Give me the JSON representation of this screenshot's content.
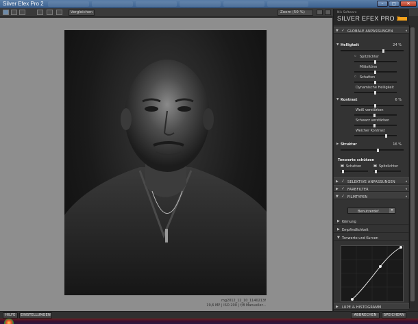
{
  "window": {
    "title": "Silver Efex Pro 2"
  },
  "toolbar": {
    "compare_label": "Vergleichen",
    "zoom_label": "Zoom (50 %)"
  },
  "photo": {
    "caption_name": "mg2012_12_10_1140213f",
    "caption_meta": "19,6 MP | ISO 200 | f/8 Manueller..."
  },
  "brand": {
    "small": "Nik Software",
    "main": "SILVER EFEX PRO",
    "version": "2"
  },
  "panel": {
    "global_header": "GLOBALE ANPASSUNGEN",
    "brightness": {
      "label": "Helligkeit",
      "value": "24 %",
      "highlights": "Spitzlichter",
      "midtones": "Mitteltöne",
      "shadows": "Schatten",
      "dynamic": "Dynamische Helligkeit"
    },
    "contrast": {
      "label": "Kontrast",
      "value": "6 %",
      "whites": "Weiß verstärken",
      "blacks": "Schwarz verstärken",
      "soft": "Weicher Kontrast"
    },
    "structure": {
      "label": "Struktur",
      "value": "16 %"
    },
    "tone_protect": {
      "label": "Tonwerte schützen",
      "shadows": "Schatten",
      "highlights": "Spitzlichter"
    },
    "selective_header": "SELEKTIVE ANPASSUNGEN",
    "colorfilter_header": "FARBFILTER",
    "filmtype_header": "FILMTYPEN",
    "film_dropdown": "Benutzerdef.",
    "grain": "Körnung",
    "sensitivity": "Empfindlichkeit",
    "levels_curves": "Tonwerte und Kurven",
    "loupe_header": "LUPE & HISTOGRAMM"
  },
  "bottom": {
    "help": "HILFE",
    "settings": "EINSTELLUNGEN",
    "cancel": "ABBRECHEN",
    "save": "SPEICHERN"
  },
  "icons": [
    "single-view-icon",
    "split-view-icon",
    "side-by-side-icon",
    "compare-split-icon",
    "zoom-dropdown-icon",
    "loupe-icon",
    "background-toggle-icon",
    "reset-icon"
  ]
}
